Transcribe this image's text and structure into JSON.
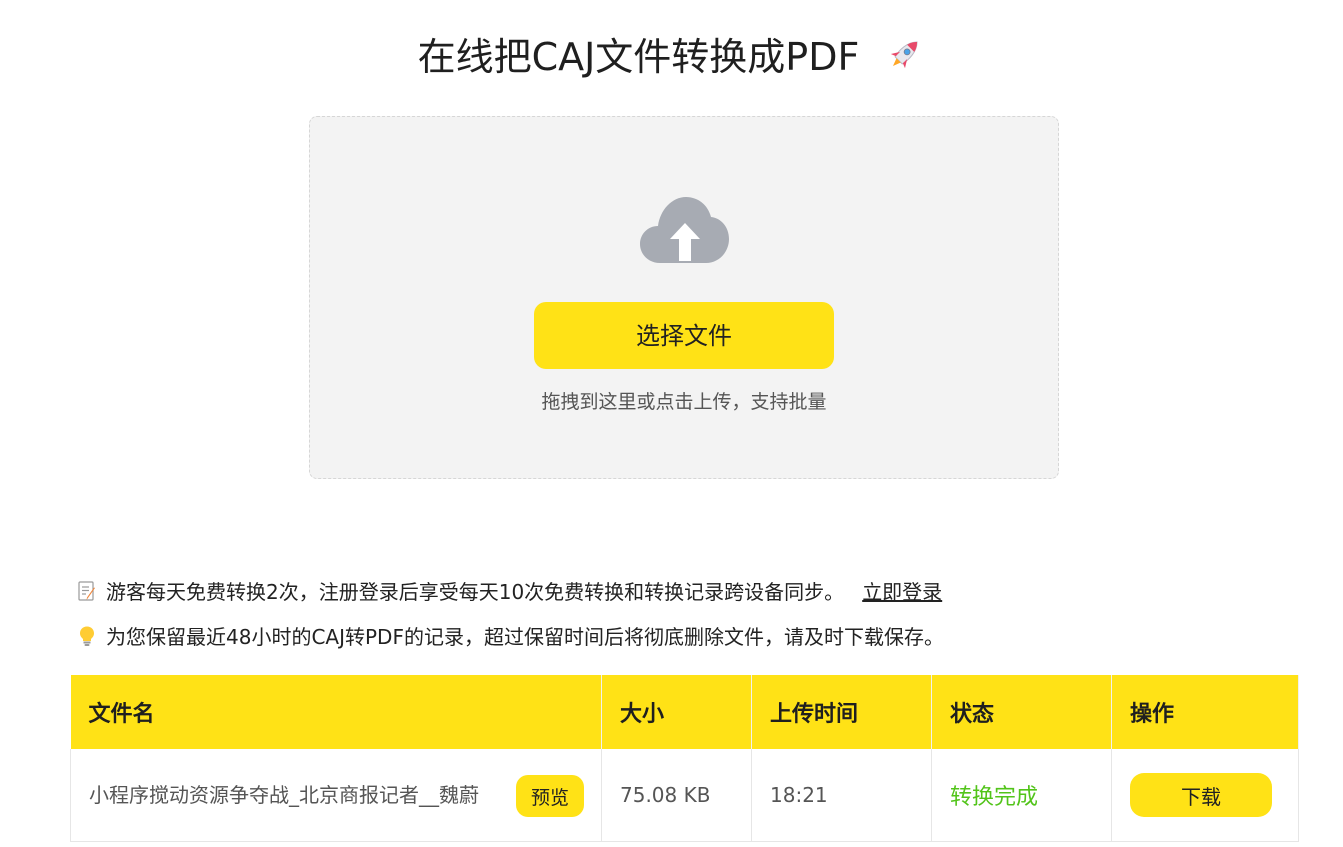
{
  "header": {
    "title": "在线把CAJ文件转换成PDF",
    "title_icon": "rocket-icon"
  },
  "upload": {
    "icon": "cloud-upload-icon",
    "select_button_label": "选择文件",
    "hint": "拖拽到这里或点击上传，支持批量"
  },
  "notices": [
    {
      "icon": "memo-icon",
      "text": "游客每天免费转换2次，注册登录后享受每天10次免费转换和转换记录跨设备同步。",
      "link_label": "立即登录"
    },
    {
      "icon": "lightbulb-icon",
      "text": "为您保留最近48小时的CAJ转PDF的记录，超过保留时间后将彻底删除文件，请及时下载保存。"
    }
  ],
  "table": {
    "headers": [
      "文件名",
      "大小",
      "上传时间",
      "状态",
      "操作"
    ],
    "rows": [
      {
        "file_name": "小程序搅动资源争夺战_北京商报记者__魏蔚",
        "preview_label": "预览",
        "size": "75.08 KB",
        "upload_time": "18:21",
        "status": "转换完成",
        "download_label": "下载"
      }
    ]
  },
  "colors": {
    "accent": "#ffe216",
    "success": "#52c41a",
    "dropzone_bg": "#f3f3f3"
  }
}
